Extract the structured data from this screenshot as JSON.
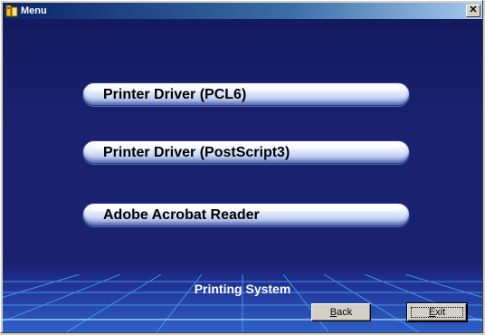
{
  "window": {
    "title": "Menu",
    "close_glyph": "✕"
  },
  "menu": {
    "items": [
      {
        "label": "Printer Driver (PCL6)"
      },
      {
        "label": "Printer Driver (PostScript3)"
      },
      {
        "label": "Adobe Acrobat Reader"
      }
    ]
  },
  "footer": {
    "label": "Printing System",
    "back_accel": "B",
    "back_rest": "ack",
    "exit_accel": "E",
    "exit_rest": "xit"
  },
  "icons": {
    "title": "app-menu-icon",
    "close": "close-icon"
  },
  "colors": {
    "background": "#1a2270",
    "grid_line": "#4fa8ff",
    "button_face": "#d4d0c8"
  }
}
